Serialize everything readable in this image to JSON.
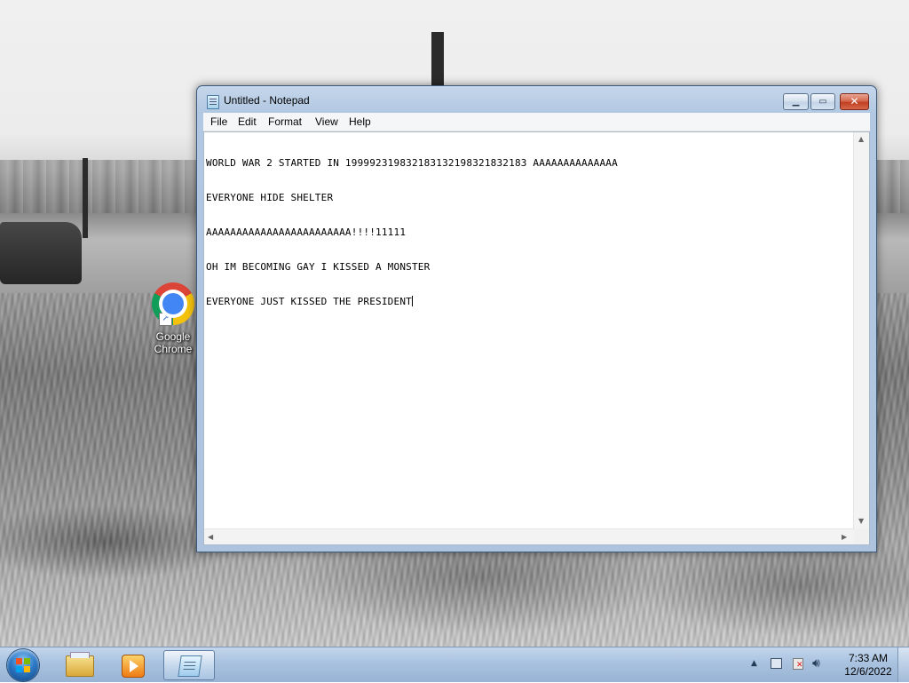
{
  "desktop": {
    "shortcuts": [
      {
        "label": "Google Chrome",
        "icon": "chrome-icon"
      }
    ]
  },
  "window": {
    "title": "Untitled - Notepad",
    "icon": "notepad-icon",
    "controls": {
      "minimize_icon": "minimize-icon",
      "maximize_icon": "maximize-icon",
      "close_icon": "close-icon"
    }
  },
  "menu": {
    "items": [
      "File",
      "Edit",
      "Format",
      "View",
      "Help"
    ]
  },
  "editor": {
    "lines": [
      "WORLD WAR 2 STARTED IN 19999231983218313219832183218З AAAAAAAAAAAAAA",
      "EVERYONE HIDE SHELTER",
      "AAAAAAAAAAAAAAAAAAAAAAAA!!!!11111",
      "OH IM BECOMING GAY I KISSED A MONSTER",
      "EVERYONE JUST KISSED THE PRESIDENT"
    ]
  },
  "taskbar": {
    "pinned": [
      {
        "name": "Windows Explorer",
        "icon": "folder-icon"
      },
      {
        "name": "Windows Media Player",
        "icon": "media-player-icon"
      },
      {
        "name": "Notepad",
        "icon": "notepad-icon",
        "active": true
      }
    ],
    "tray": {
      "clock_time": "7:33 AM",
      "clock_date": "12/6/2022",
      "icons": [
        "chevron-up-icon",
        "network-icon",
        "action-center-flag-icon",
        "speaker-icon"
      ]
    }
  },
  "colors": {
    "taskbar_bg": "#a9c2df",
    "window_frame": "#b2c8e2",
    "close_button": "#c13f22"
  }
}
